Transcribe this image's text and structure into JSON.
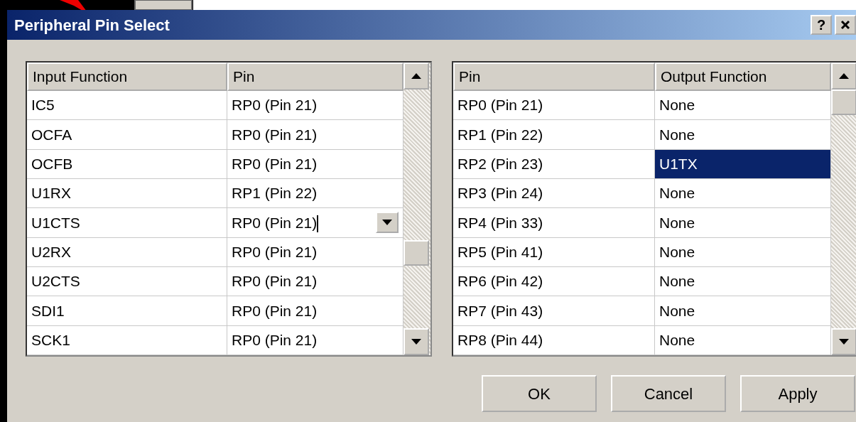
{
  "window": {
    "title": "Peripheral Pin Select",
    "help_button": "?"
  },
  "input_table": {
    "columns": [
      "Input Function",
      "Pin"
    ],
    "rows": [
      {
        "function": "IC5",
        "pin": "RP0 (Pin 21)",
        "editing": false
      },
      {
        "function": "OCFA",
        "pin": "RP0 (Pin 21)",
        "editing": false
      },
      {
        "function": "OCFB",
        "pin": "RP0 (Pin 21)",
        "editing": false
      },
      {
        "function": "U1RX",
        "pin": "RP1 (Pin 22)",
        "editing": false
      },
      {
        "function": "U1CTS",
        "pin": "RP0 (Pin 21)",
        "editing": true
      },
      {
        "function": "U2RX",
        "pin": "RP0 (Pin 21)",
        "editing": false
      },
      {
        "function": "U2CTS",
        "pin": "RP0 (Pin 21)",
        "editing": false
      },
      {
        "function": "SDI1",
        "pin": "RP0 (Pin 21)",
        "editing": false
      },
      {
        "function": "SCK1",
        "pin": "RP0 (Pin 21)",
        "editing": false
      }
    ]
  },
  "output_table": {
    "columns": [
      "Pin",
      "Output Function"
    ],
    "rows": [
      {
        "pin": "RP0 (Pin 21)",
        "function": "None",
        "selected": false
      },
      {
        "pin": "RP1 (Pin 22)",
        "function": "None",
        "selected": false
      },
      {
        "pin": "RP2 (Pin 23)",
        "function": "U1TX",
        "selected": true
      },
      {
        "pin": "RP3 (Pin 24)",
        "function": "None",
        "selected": false
      },
      {
        "pin": "RP4 (Pin 33)",
        "function": "None",
        "selected": false
      },
      {
        "pin": "RP5 (Pin 41)",
        "function": "None",
        "selected": false
      },
      {
        "pin": "RP6 (Pin 42)",
        "function": "None",
        "selected": false
      },
      {
        "pin": "RP7 (Pin 43)",
        "function": "None",
        "selected": false
      },
      {
        "pin": "RP8 (Pin 44)",
        "function": "None",
        "selected": false
      }
    ]
  },
  "buttons": [
    "OK",
    "Cancel",
    "Apply"
  ]
}
